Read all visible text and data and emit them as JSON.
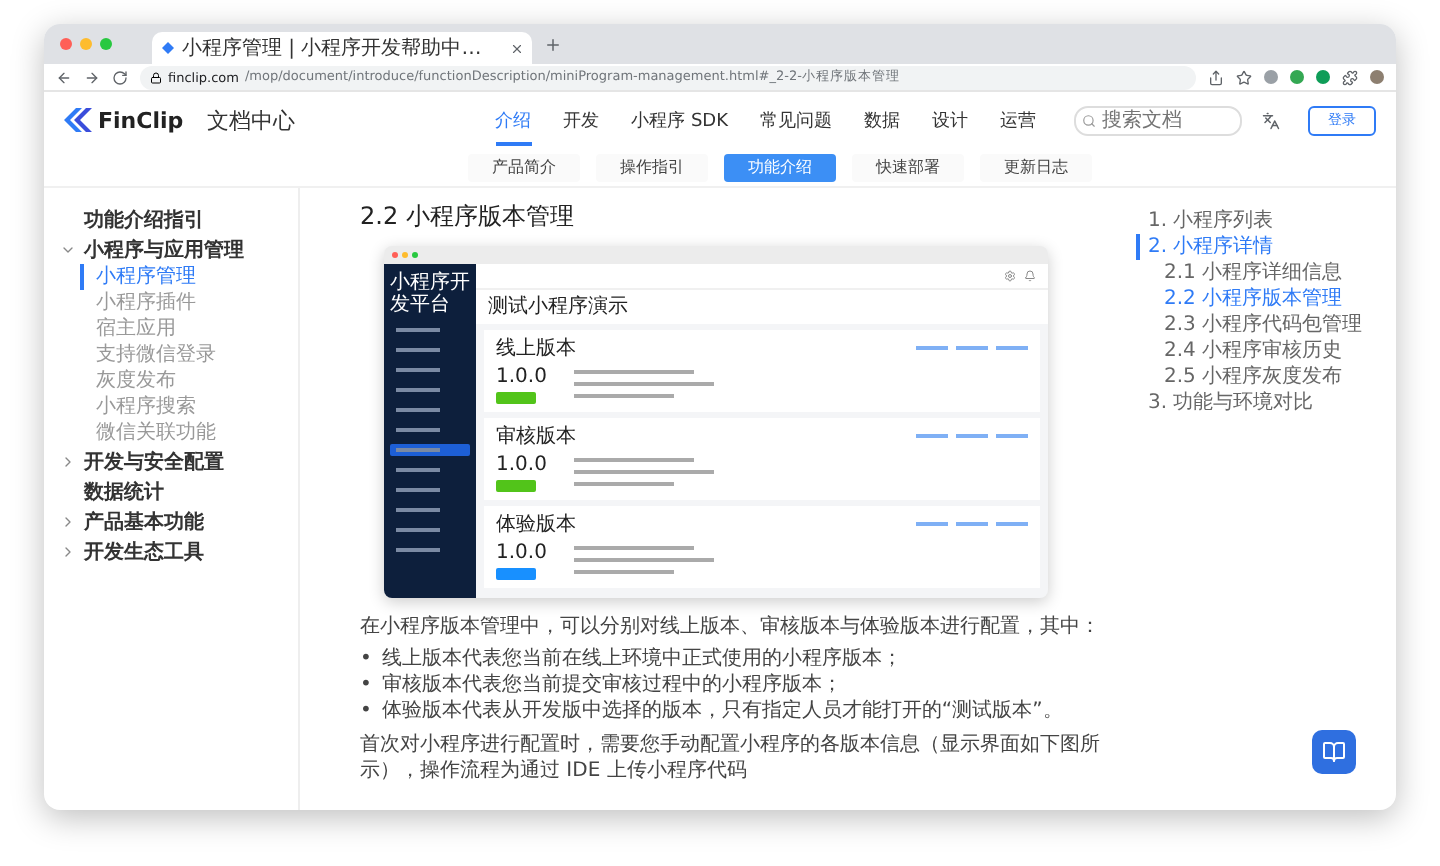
{
  "browser": {
    "tab_title": "小程序管理 | 小程序开发帮助中…",
    "url_domain": "finclip.com",
    "url_path": "/mop/document/introduce/functionDescription/miniProgram-management.html#_2-2-小程序版本管理"
  },
  "header": {
    "logo": "FinClip",
    "site_title": "文档中心",
    "search": {
      "placeholder": "搜索文档"
    },
    "login": "登录",
    "nav": [
      {
        "label": "介绍",
        "selected": true
      },
      {
        "label": "开发",
        "selected": false
      },
      {
        "label": "小程序 SDK",
        "selected": false
      },
      {
        "label": "常见问题",
        "selected": false
      },
      {
        "label": "数据",
        "selected": false
      },
      {
        "label": "设计",
        "selected": false
      },
      {
        "label": "运营",
        "selected": false
      }
    ]
  },
  "subnav": [
    {
      "label": "产品简介",
      "selected": false
    },
    {
      "label": "操作指引",
      "selected": false
    },
    {
      "label": "功能介绍",
      "selected": true
    },
    {
      "label": "快速部署",
      "selected": false
    },
    {
      "label": "更新日志",
      "selected": false
    }
  ],
  "sidebar": [
    {
      "kind": "link",
      "label": "功能介绍指引"
    },
    {
      "kind": "group",
      "label": "小程序与应用管理",
      "expanded": true,
      "children": [
        {
          "label": "小程序管理",
          "selected": true
        },
        {
          "label": "小程序插件",
          "selected": false
        },
        {
          "label": "宿主应用",
          "selected": false
        },
        {
          "label": "支持微信登录",
          "selected": false
        },
        {
          "label": "灰度发布",
          "selected": false
        },
        {
          "label": "小程序搜索",
          "selected": false
        },
        {
          "label": "微信关联功能",
          "selected": false
        }
      ]
    },
    {
      "kind": "group",
      "label": "开发与安全配置",
      "expanded": false
    },
    {
      "kind": "link",
      "label": "数据统计"
    },
    {
      "kind": "group",
      "label": "产品基本功能",
      "expanded": false
    },
    {
      "kind": "group",
      "label": "开发生态工具",
      "expanded": false
    }
  ],
  "article": {
    "heading": "2.2 小程序版本管理",
    "figure": {
      "brand": "小程序开发平台",
      "page_title": "测试小程序演示",
      "menu": [
        {
          "selected": false
        },
        {
          "selected": false
        },
        {
          "selected": false
        },
        {
          "selected": false
        },
        {
          "selected": false
        },
        {
          "selected": false
        },
        {
          "selected": true
        },
        {
          "selected": false
        },
        {
          "selected": false
        },
        {
          "selected": false
        },
        {
          "selected": false
        },
        {
          "selected": false
        }
      ],
      "cards": [
        {
          "title": "线上版本",
          "version": "1.0.0",
          "color": "#52c41a"
        },
        {
          "title": "审核版本",
          "version": "1.0.0",
          "color": "#52c41a"
        },
        {
          "title": "体验版本",
          "version": "1.0.0",
          "color": "#1890ff"
        }
      ]
    },
    "intro": "在小程序版本管理中，可以分别对线上版本、审核版本与体验版本进行配置，其中：",
    "bullets": [
      {
        "marker": "•",
        "text": "线上版本代表您当前在线上环境中正式使用的小程序版本；"
      },
      {
        "marker": "•",
        "text": "审核版本代表您当前提交审核过程中的小程序版本；"
      },
      {
        "marker": "•",
        "text": "体验版本代表从开发版中选择的版本，只有指定人员才能打开的“测试版本”。"
      }
    ],
    "outro": "首次对小程序进行配置时，需要您手动配置小程序的各版本信息（显示界面如下图所示），操作流程为通过 IDE 上传小程序代码"
  },
  "toc": [
    {
      "label": "1. 小程序列表",
      "selected": false
    },
    {
      "label": "2. 小程序详情",
      "selected": true,
      "children": [
        {
          "label": "2.1 小程序详细信息",
          "selected": false
        },
        {
          "label": "2.2 小程序版本管理",
          "selected": true
        },
        {
          "label": "2.3 小程序代码包管理",
          "selected": false
        },
        {
          "label": "2.4 小程序审核历史",
          "selected": false
        },
        {
          "label": "2.5 小程序灰度发布",
          "selected": false
        }
      ]
    },
    {
      "label": "3. 功能与环境对比",
      "selected": false
    }
  ]
}
